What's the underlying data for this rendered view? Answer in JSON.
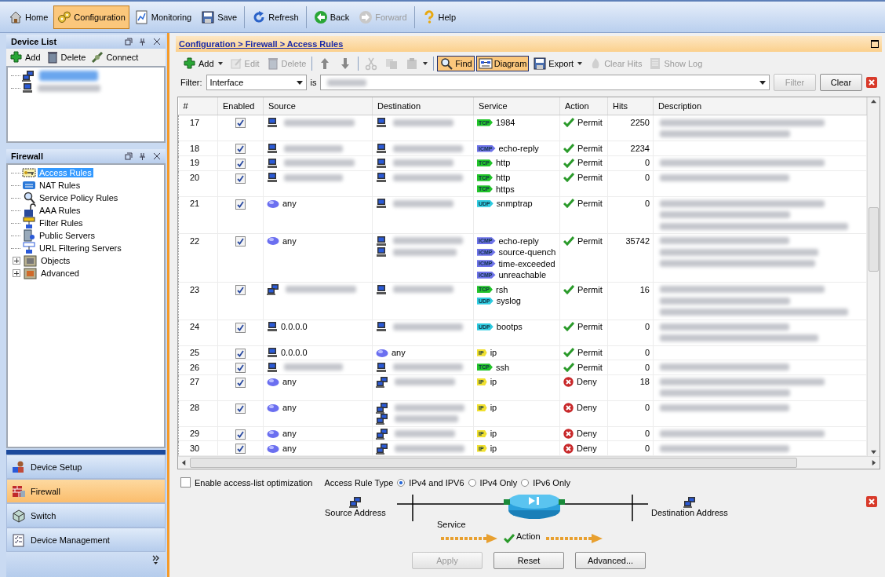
{
  "toolbar": [
    {
      "kind": "home",
      "label": "Home",
      "selected": false,
      "disabled": false
    },
    {
      "kind": "configuration",
      "label": "Configuration",
      "selected": true,
      "disabled": false
    },
    {
      "kind": "monitoring",
      "label": "Monitoring",
      "selected": false,
      "disabled": false
    },
    {
      "kind": "save",
      "label": "Save",
      "selected": false,
      "disabled": false
    },
    {
      "kind": "refresh",
      "label": "Refresh",
      "selected": false,
      "disabled": false
    },
    {
      "kind": "back",
      "label": "Back",
      "selected": false,
      "disabled": false
    },
    {
      "kind": "forward",
      "label": "Forward",
      "selected": false,
      "disabled": true
    },
    {
      "kind": "help",
      "label": "Help",
      "selected": false,
      "disabled": false
    }
  ],
  "device_list": {
    "title": "Device List",
    "actions": [
      {
        "kind": "add",
        "label": "Add"
      },
      {
        "kind": "delete",
        "label": "Delete"
      },
      {
        "kind": "connect",
        "label": "Connect"
      }
    ],
    "items": [
      {
        "kind": "network",
        "redacted": true,
        "selected": true
      },
      {
        "kind": "host",
        "redacted": true,
        "selected": false
      }
    ]
  },
  "firewall_tree": {
    "title": "Firewall",
    "items": [
      {
        "kind": "access",
        "label": "Access Rules",
        "selected": true
      },
      {
        "kind": "nat",
        "label": "NAT Rules",
        "selected": false
      },
      {
        "kind": "policy",
        "label": "Service Policy Rules",
        "selected": false
      },
      {
        "kind": "aaa",
        "label": "AAA Rules",
        "selected": false
      },
      {
        "kind": "filter",
        "label": "Filter Rules",
        "selected": false
      },
      {
        "kind": "servers",
        "label": "Public Servers",
        "selected": false
      },
      {
        "kind": "url",
        "label": "URL Filtering Servers",
        "selected": false
      },
      {
        "kind": "objects",
        "label": "Objects",
        "selected": false,
        "expanded": false
      },
      {
        "kind": "advanced",
        "label": "Advanced",
        "selected": false,
        "expanded": false
      }
    ]
  },
  "nav": [
    {
      "kind": "setup",
      "label": "Device Setup",
      "selected": false
    },
    {
      "kind": "firewall",
      "label": "Firewall",
      "selected": true
    },
    {
      "kind": "switch",
      "label": "Switch",
      "selected": false
    },
    {
      "kind": "management",
      "label": "Device Management",
      "selected": false
    }
  ],
  "breadcrumb": "Configuration > Firewall > Access Rules",
  "actions": [
    {
      "kind": "add",
      "label": "Add",
      "disabled": false,
      "dropdown": true,
      "toggled": false
    },
    {
      "kind": "edit",
      "label": "Edit",
      "disabled": true,
      "dropdown": false,
      "toggled": false
    },
    {
      "kind": "delete",
      "label": "Delete",
      "disabled": true,
      "dropdown": false,
      "toggled": false
    },
    {
      "kind": "up",
      "disabled": false,
      "dropdown": false,
      "toggled": false
    },
    {
      "kind": "down",
      "disabled": false,
      "dropdown": false,
      "toggled": false
    },
    {
      "kind": "cut",
      "disabled": true,
      "dropdown": false,
      "toggled": false
    },
    {
      "kind": "copy",
      "disabled": true,
      "dropdown": false,
      "toggled": false
    },
    {
      "kind": "paste",
      "disabled": true,
      "dropdown": true,
      "toggled": false
    },
    {
      "kind": "find",
      "label": "Find",
      "disabled": false,
      "dropdown": false,
      "toggled": true
    },
    {
      "kind": "diagram",
      "label": "Diagram",
      "disabled": false,
      "dropdown": false,
      "toggled": true
    },
    {
      "kind": "export",
      "label": "Export",
      "disabled": false,
      "dropdown": true,
      "toggled": false
    },
    {
      "kind": "clearhits",
      "label": "Clear Hits",
      "disabled": true,
      "dropdown": false,
      "toggled": false
    },
    {
      "kind": "log",
      "label": "Show Log",
      "disabled": true,
      "dropdown": false,
      "toggled": false
    }
  ],
  "filter": {
    "label": "Filter:",
    "field": "Interface",
    "operator": "is",
    "value_redacted": true,
    "buttons": [
      {
        "label": "Filter",
        "disabled": true
      },
      {
        "label": "Clear",
        "disabled": false
      }
    ]
  },
  "table": {
    "columns": [
      "#",
      "Enabled",
      "Source",
      "Destination",
      "Service",
      "Action",
      "Hits",
      "Description"
    ],
    "rows": [
      {
        "no": "17",
        "enabled": true,
        "source": [
          {
            "kind": "host",
            "redacted": true
          }
        ],
        "destination": [
          {
            "kind": "host",
            "redacted": true
          }
        ],
        "services": [
          {
            "kind": "tcp",
            "protocol": "TCP",
            "name": "1984"
          }
        ],
        "action": {
          "kind": "permit",
          "label": "Permit"
        },
        "hits": "2250",
        "description": [
          {
            "redacted": true
          },
          {
            "redacted": true
          }
        ]
      },
      {
        "no": "18",
        "enabled": true,
        "source": [
          {
            "kind": "host",
            "redacted": true
          }
        ],
        "destination": [
          {
            "kind": "host",
            "redacted": true
          }
        ],
        "services": [
          {
            "kind": "icmp",
            "protocol": "ICMP",
            "name": "echo-reply"
          }
        ],
        "action": {
          "kind": "permit",
          "label": "Permit"
        },
        "hits": "2234"
      },
      {
        "no": "19",
        "enabled": true,
        "source": [
          {
            "kind": "host",
            "redacted": true
          }
        ],
        "destination": [
          {
            "kind": "host",
            "redacted": true
          }
        ],
        "services": [
          {
            "kind": "tcp",
            "protocol": "TCP",
            "name": "http"
          }
        ],
        "action": {
          "kind": "permit",
          "label": "Permit"
        },
        "hits": "0",
        "description": [
          {
            "redacted": true
          }
        ]
      },
      {
        "no": "20",
        "enabled": true,
        "source": [
          {
            "kind": "host",
            "redacted": true
          }
        ],
        "destination": [
          {
            "kind": "host",
            "redacted": true
          }
        ],
        "services": [
          {
            "kind": "tcp",
            "protocol": "TCP",
            "name": "http"
          },
          {
            "kind": "tcp",
            "protocol": "TCP",
            "name": "https"
          }
        ],
        "action": {
          "kind": "permit",
          "label": "Permit"
        },
        "hits": "0",
        "description": [
          {
            "redacted": true
          }
        ]
      },
      {
        "no": "21",
        "enabled": true,
        "source": [
          {
            "kind": "any",
            "text": "any"
          }
        ],
        "destination": [
          {
            "kind": "host",
            "redacted": true
          }
        ],
        "services": [
          {
            "kind": "udp",
            "protocol": "UDP",
            "name": "snmptrap"
          }
        ],
        "action": {
          "kind": "permit",
          "label": "Permit"
        },
        "hits": "0",
        "description": [
          {
            "redacted": true
          },
          {
            "redacted": true
          },
          {
            "redacted": true
          }
        ]
      },
      {
        "no": "22",
        "enabled": true,
        "source": [
          {
            "kind": "any",
            "text": "any"
          }
        ],
        "destination": [
          {
            "kind": "host",
            "redacted": true
          },
          {
            "kind": "host",
            "redacted": true
          }
        ],
        "services": [
          {
            "kind": "icmp",
            "protocol": "ICMP",
            "name": "echo-reply"
          },
          {
            "kind": "icmp",
            "protocol": "ICMP",
            "name": "source-quench"
          },
          {
            "kind": "icmp",
            "protocol": "ICMP",
            "name": "time-exceeded"
          },
          {
            "kind": "icmp",
            "protocol": "ICMP",
            "name": "unreachable"
          }
        ],
        "action": {
          "kind": "permit",
          "label": "Permit"
        },
        "hits": "35742",
        "description": [
          {
            "redacted": true
          },
          {
            "redacted": true
          },
          {
            "redacted": true
          }
        ]
      },
      {
        "no": "23",
        "enabled": true,
        "source": [
          {
            "kind": "network",
            "redacted": true
          }
        ],
        "destination": [
          {
            "kind": "host",
            "redacted": true
          }
        ],
        "services": [
          {
            "kind": "tcp",
            "protocol": "TCP",
            "name": "rsh"
          },
          {
            "kind": "udp",
            "protocol": "UDP",
            "name": "syslog"
          }
        ],
        "action": {
          "kind": "permit",
          "label": "Permit"
        },
        "hits": "16",
        "description": [
          {
            "redacted": true
          },
          {
            "redacted": true
          },
          {
            "redacted": true
          }
        ]
      },
      {
        "no": "24",
        "enabled": true,
        "source": [
          {
            "kind": "host",
            "text": "0.0.0.0"
          }
        ],
        "destination": [
          {
            "kind": "host",
            "redacted": true
          }
        ],
        "services": [
          {
            "kind": "udp",
            "protocol": "UDP",
            "name": "bootps"
          }
        ],
        "action": {
          "kind": "permit",
          "label": "Permit"
        },
        "hits": "0",
        "description": [
          {
            "redacted": true
          },
          {
            "redacted": true
          }
        ]
      },
      {
        "no": "25",
        "enabled": true,
        "source": [
          {
            "kind": "host",
            "text": "0.0.0.0"
          }
        ],
        "destination": [
          {
            "kind": "any",
            "text": "any"
          }
        ],
        "services": [
          {
            "kind": "ip",
            "protocol": "IP",
            "name": "ip"
          }
        ],
        "action": {
          "kind": "permit",
          "label": "Permit"
        },
        "hits": "0"
      },
      {
        "no": "26",
        "enabled": true,
        "source": [
          {
            "kind": "host",
            "redacted": true
          }
        ],
        "destination": [
          {
            "kind": "host",
            "redacted": true
          }
        ],
        "services": [
          {
            "kind": "tcp",
            "protocol": "TCP",
            "name": "ssh"
          }
        ],
        "action": {
          "kind": "permit",
          "label": "Permit"
        },
        "hits": "0",
        "description": [
          {
            "redacted": true
          }
        ]
      },
      {
        "no": "27",
        "enabled": true,
        "source": [
          {
            "kind": "any",
            "text": "any"
          }
        ],
        "destination": [
          {
            "kind": "network",
            "redacted": true
          }
        ],
        "services": [
          {
            "kind": "ip",
            "protocol": "IP",
            "name": "ip"
          }
        ],
        "action": {
          "kind": "deny",
          "label": "Deny"
        },
        "hits": "18",
        "description": [
          {
            "redacted": true
          },
          {
            "redacted": true
          }
        ]
      },
      {
        "no": "28",
        "enabled": true,
        "source": [
          {
            "kind": "any",
            "text": "any"
          }
        ],
        "destination": [
          {
            "kind": "network",
            "redacted": true
          },
          {
            "kind": "network",
            "redacted": true
          }
        ],
        "services": [
          {
            "kind": "ip",
            "protocol": "IP",
            "name": "ip"
          }
        ],
        "action": {
          "kind": "deny",
          "label": "Deny"
        },
        "hits": "0",
        "description": [
          {
            "redacted": true
          }
        ]
      },
      {
        "no": "29",
        "enabled": true,
        "source": [
          {
            "kind": "any",
            "text": "any"
          }
        ],
        "destination": [
          {
            "kind": "network",
            "redacted": true
          }
        ],
        "services": [
          {
            "kind": "ip",
            "protocol": "IP",
            "name": "ip"
          }
        ],
        "action": {
          "kind": "deny",
          "label": "Deny"
        },
        "hits": "0",
        "description": [
          {
            "redacted": true
          }
        ]
      },
      {
        "no": "30",
        "enabled": true,
        "source": [
          {
            "kind": "any",
            "text": "any"
          }
        ],
        "destination": [
          {
            "kind": "network",
            "redacted": true
          }
        ],
        "services": [
          {
            "kind": "ip",
            "protocol": "IP",
            "name": "ip"
          }
        ],
        "action": {
          "kind": "deny",
          "label": "Deny"
        },
        "hits": "0",
        "description": [
          {
            "redacted": true
          }
        ]
      }
    ]
  },
  "options": {
    "optimization": {
      "label": "Enable access-list optimization",
      "checked": false
    },
    "rule_type": {
      "label": "Access Rule Type",
      "options": [
        {
          "label": "IPv4 and IPV6",
          "selected": true
        },
        {
          "label": "IPv4 Only",
          "selected": false
        },
        {
          "label": "IPv6 Only",
          "selected": false
        }
      ]
    }
  },
  "diagram": {
    "source": "Source Address",
    "service": "Service",
    "action": "Action",
    "destination": "Destination Address"
  },
  "buttons": [
    {
      "label": "Apply",
      "disabled": true
    },
    {
      "label": "Reset",
      "disabled": false
    },
    {
      "label": "Advanced...",
      "disabled": false
    }
  ]
}
